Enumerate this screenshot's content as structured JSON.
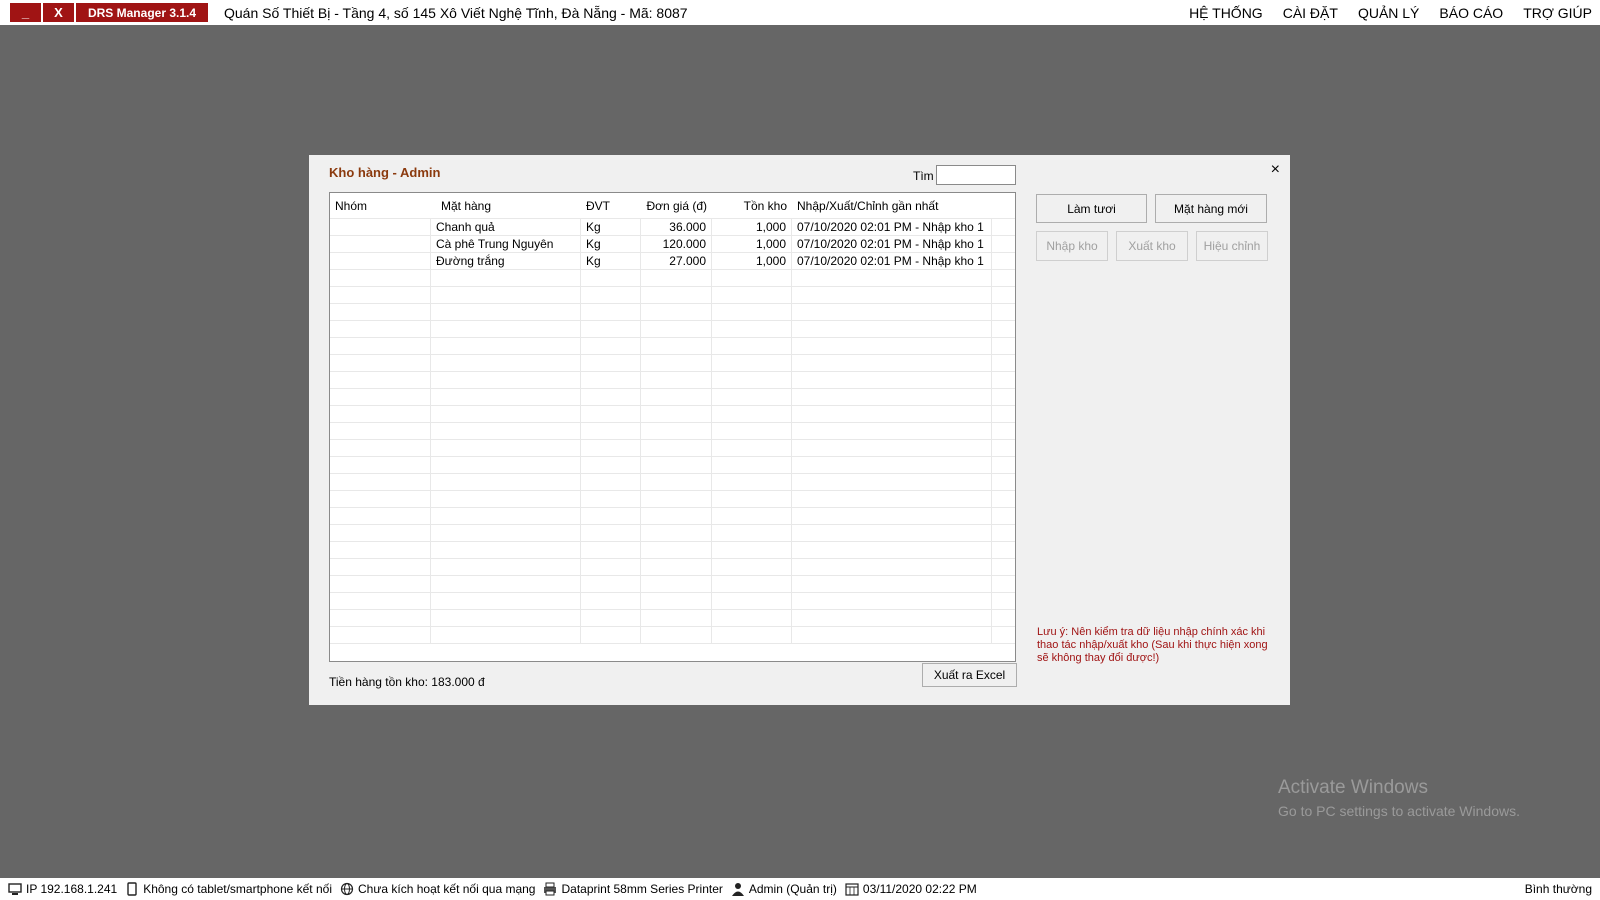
{
  "topbar": {
    "min_label": "_",
    "close_label": "X",
    "app_title": "DRS Manager 3.1.4",
    "shop_info": "Quán Số Thiết Bị -  Tầng 4, số 145 Xô Viết Nghệ Tĩnh, Đà Nẵng -  Mã: 8087"
  },
  "menu": {
    "items": [
      {
        "label": "HỆ THỐNG"
      },
      {
        "label": "CÀI ĐẶT"
      },
      {
        "label": "QUẢN LÝ"
      },
      {
        "label": "BÁO CÁO"
      },
      {
        "label": "TRỢ GIÚP"
      }
    ]
  },
  "dialog": {
    "title": "Kho hàng - Admin",
    "close": "×",
    "search_label": "Tìm",
    "search_value": "",
    "columns": [
      "Nhóm",
      "Mặt hàng",
      "ĐVT",
      "Đơn giá (đ)",
      "Tồn kho",
      "Nhập/Xuất/Chỉnh gần nhất"
    ],
    "rows": [
      [
        "",
        "Chanh quả",
        "Kg",
        "36.000",
        "1,000",
        "07/10/2020 02:01 PM - Nhập kho 1"
      ],
      [
        "",
        "Cà phê Trung Nguyên",
        "Kg",
        "120.000",
        "1,000",
        "07/10/2020 02:01 PM - Nhập kho 1"
      ],
      [
        "",
        "Đường trắng",
        "Kg",
        "27.000",
        "1,000",
        "07/10/2020 02:01 PM - Nhập kho 1"
      ]
    ],
    "total": "Tiền hàng tồn kho: 183.000 đ",
    "export_excel": "Xuất ra Excel",
    "refresh": "Làm tươi",
    "new_item": "Mặt hàng mới",
    "import": "Nhập kho",
    "export": "Xuất kho",
    "adjust": "Hiệu chỉnh",
    "note": "Lưu ý: Nên kiểm tra dữ liệu nhập chính xác khi thao tác nhập/xuất kho (Sau khi thực hiện xong sẽ không thay đổi được!)"
  },
  "watermark": {
    "line1": "Activate Windows",
    "line2": "Go to PC settings to activate Windows."
  },
  "statusbar": {
    "ip": "IP 192.168.1.241",
    "tablet": "Không có tablet/smartphone kết nối",
    "network": "Chưa kích hoạt kết nối qua mạng",
    "printer": "Dataprint 58mm Series Printer",
    "user": "Admin (Quản trị)",
    "datetime": "03/11/2020 02:22 PM",
    "mode": "Bình thường"
  }
}
